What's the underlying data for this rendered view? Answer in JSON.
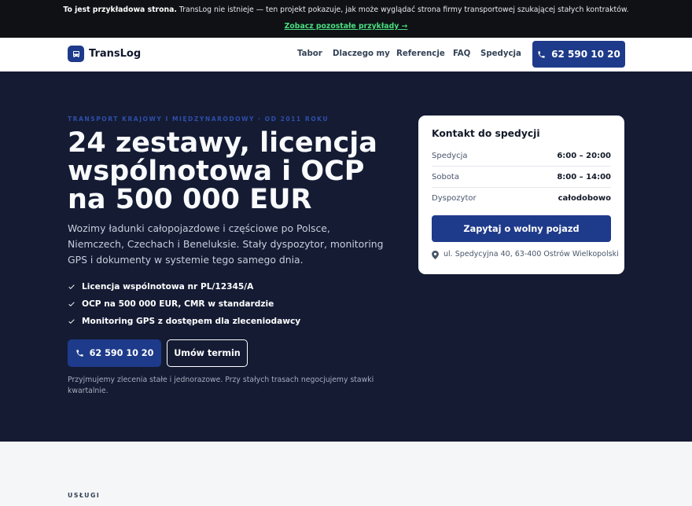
{
  "banner": {
    "bold": "To jest przykładowa strona.",
    "text": " TransLog nie istnieje — ten projekt pokazuje, jak może wyglądać strona firmy transportowej szukającej stałych kontraktów.",
    "link": "Zobacz pozostałe przykłady →"
  },
  "header": {
    "brand": "TransLog",
    "nav": [
      "Tabor",
      "Dlaczego my",
      "Referencje",
      "FAQ",
      "Spedycja"
    ],
    "phone": "62 590 10 20"
  },
  "hero": {
    "eyebrow": "TRANSPORT KRAJOWY I MIĘDZYNARODOWY · OD 2011 ROKU",
    "title": "24 zestawy, licencja wspólnotowa i OCP na 500 000 EUR",
    "description": "Wozimy ładunki całopojazdowe i częściowe po Polsce, Niemczech, Czechach i Beneluksie. Stały dyspozytor, monitoring GPS i dokumenty w systemie tego samego dnia.",
    "checks": [
      "Licencja wspólnotowa nr PL/12345/A",
      "OCP na 500 000 EUR, CMR w standardzie",
      "Monitoring GPS z dostępem dla zleceniodawcy"
    ],
    "phone_button": "62 590 10 20",
    "book_button": "Umów termin",
    "note": "Przyjmujemy zlecenia stałe i jednorazowe. Przy stałych trasach negocjujemy stawki kwartalnie."
  },
  "contact": {
    "title": "Kontakt do spedycji",
    "rows": [
      {
        "label": "Spedycja",
        "value": "6:00 – 20:00"
      },
      {
        "label": "Sobota",
        "value": "8:00 – 14:00"
      },
      {
        "label": "Dyspozytor",
        "value": "całodobowo"
      }
    ],
    "button": "Zapytaj o wolny pojazd",
    "address": "ul. Spedycyjna 40, 63-400 Ostrów Wielkopolski"
  },
  "services": {
    "label": "USŁUGI"
  },
  "colors": {
    "brand": "#1e3a8a",
    "hero_bg": "#141b33",
    "banner_link": "#4ade80"
  }
}
